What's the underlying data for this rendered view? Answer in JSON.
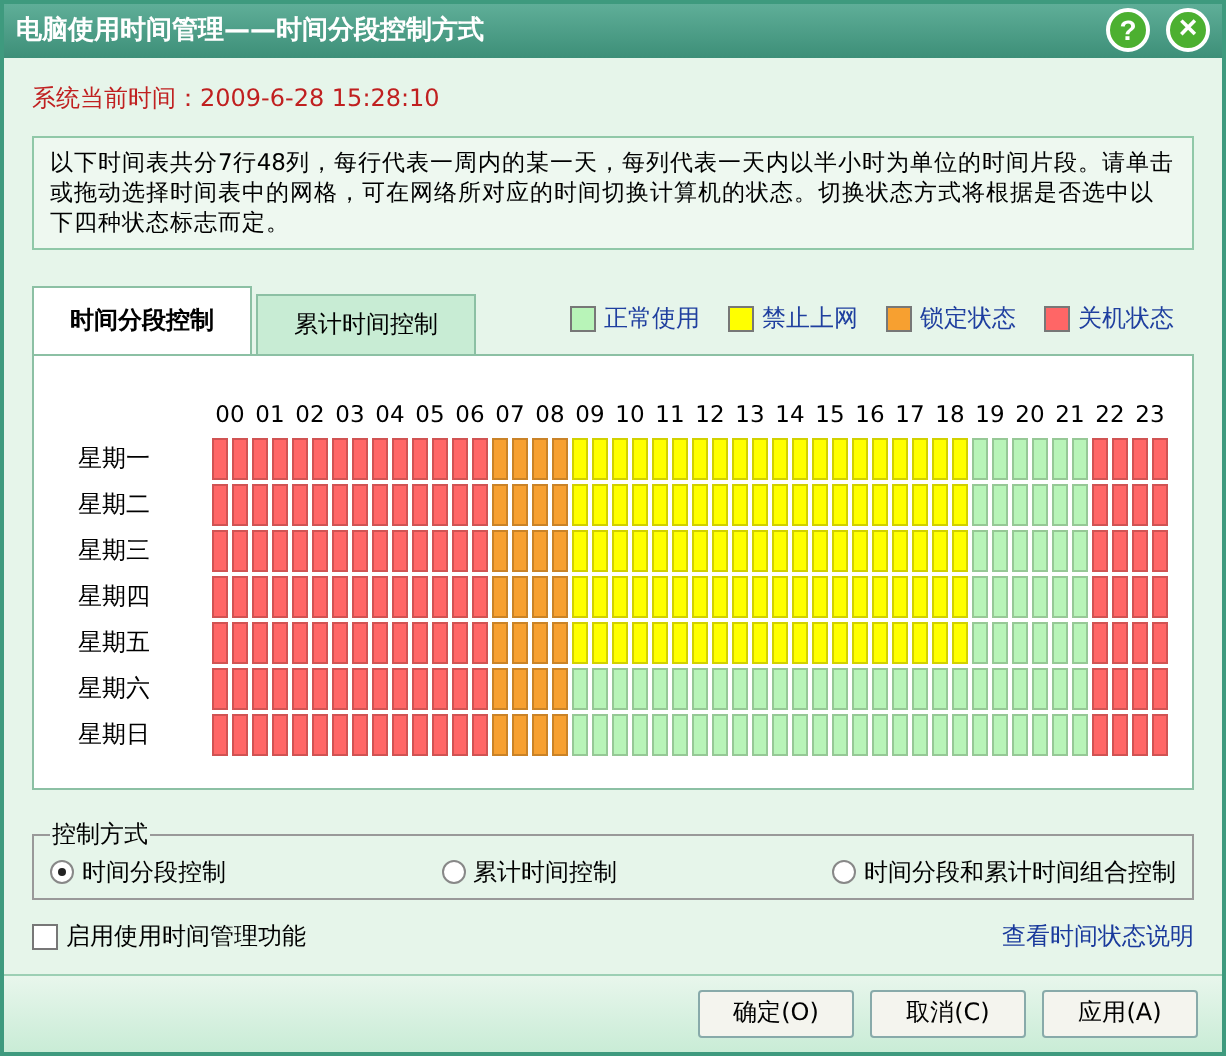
{
  "window": {
    "title": "电脑使用时间管理——时间分段控制方式",
    "buttons": [
      {
        "kind": "help",
        "label": "?"
      },
      {
        "kind": "close",
        "label": "×"
      }
    ]
  },
  "system_time": "系统当前时间：2009-6-28 15:28:10",
  "description": "以下时间表共分7行48列，每行代表一周内的某一天，每列代表一天内以半小时为单位的时间片段。请单击或拖动选择时间表中的网格，可在网络所对应的时间切换计算机的状态。切换状态方式将根据是否选中以下四种状态标志而定。",
  "tabs": [
    {
      "label": "时间分段控制",
      "selected": true
    },
    {
      "label": "累计时间控制",
      "selected": false
    }
  ],
  "legend": [
    {
      "kind": "normal",
      "label": "正常使用",
      "color": "#b8f4b8"
    },
    {
      "kind": "blocked",
      "label": "禁止上网",
      "color": "#ffff00"
    },
    {
      "kind": "locked",
      "label": "锁定状态",
      "color": "#f7a030"
    },
    {
      "kind": "off",
      "label": "关机状态",
      "color": "#ff6666"
    }
  ],
  "grid": {
    "hours": [
      "00",
      "01",
      "02",
      "03",
      "04",
      "05",
      "06",
      "07",
      "08",
      "09",
      "10",
      "11",
      "12",
      "13",
      "14",
      "15",
      "16",
      "17",
      "18",
      "19",
      "20",
      "21",
      "22",
      "23"
    ],
    "rows": [
      {
        "day": "星期一",
        "cells": [
          {
            "kind": "off"
          },
          {
            "kind": "off"
          },
          {
            "kind": "off"
          },
          {
            "kind": "off"
          },
          {
            "kind": "off"
          },
          {
            "kind": "off"
          },
          {
            "kind": "off"
          },
          {
            "kind": "off"
          },
          {
            "kind": "off"
          },
          {
            "kind": "off"
          },
          {
            "kind": "off"
          },
          {
            "kind": "off"
          },
          {
            "kind": "off"
          },
          {
            "kind": "off"
          },
          {
            "kind": "locked"
          },
          {
            "kind": "locked"
          },
          {
            "kind": "locked"
          },
          {
            "kind": "locked"
          },
          {
            "kind": "blocked"
          },
          {
            "kind": "blocked"
          },
          {
            "kind": "blocked"
          },
          {
            "kind": "blocked"
          },
          {
            "kind": "blocked"
          },
          {
            "kind": "blocked"
          },
          {
            "kind": "blocked"
          },
          {
            "kind": "blocked"
          },
          {
            "kind": "blocked"
          },
          {
            "kind": "blocked"
          },
          {
            "kind": "blocked"
          },
          {
            "kind": "blocked"
          },
          {
            "kind": "blocked"
          },
          {
            "kind": "blocked"
          },
          {
            "kind": "blocked"
          },
          {
            "kind": "blocked"
          },
          {
            "kind": "blocked"
          },
          {
            "kind": "blocked"
          },
          {
            "kind": "blocked"
          },
          {
            "kind": "blocked"
          },
          {
            "kind": "normal"
          },
          {
            "kind": "normal"
          },
          {
            "kind": "normal"
          },
          {
            "kind": "normal"
          },
          {
            "kind": "normal"
          },
          {
            "kind": "normal"
          },
          {
            "kind": "off"
          },
          {
            "kind": "off"
          },
          {
            "kind": "off"
          },
          {
            "kind": "off"
          }
        ]
      },
      {
        "day": "星期二",
        "cells": [
          {
            "kind": "off"
          },
          {
            "kind": "off"
          },
          {
            "kind": "off"
          },
          {
            "kind": "off"
          },
          {
            "kind": "off"
          },
          {
            "kind": "off"
          },
          {
            "kind": "off"
          },
          {
            "kind": "off"
          },
          {
            "kind": "off"
          },
          {
            "kind": "off"
          },
          {
            "kind": "off"
          },
          {
            "kind": "off"
          },
          {
            "kind": "off"
          },
          {
            "kind": "off"
          },
          {
            "kind": "locked"
          },
          {
            "kind": "locked"
          },
          {
            "kind": "locked"
          },
          {
            "kind": "locked"
          },
          {
            "kind": "blocked"
          },
          {
            "kind": "blocked"
          },
          {
            "kind": "blocked"
          },
          {
            "kind": "blocked"
          },
          {
            "kind": "blocked"
          },
          {
            "kind": "blocked"
          },
          {
            "kind": "blocked"
          },
          {
            "kind": "blocked"
          },
          {
            "kind": "blocked"
          },
          {
            "kind": "blocked"
          },
          {
            "kind": "blocked"
          },
          {
            "kind": "blocked"
          },
          {
            "kind": "blocked"
          },
          {
            "kind": "blocked"
          },
          {
            "kind": "blocked"
          },
          {
            "kind": "blocked"
          },
          {
            "kind": "blocked"
          },
          {
            "kind": "blocked"
          },
          {
            "kind": "blocked"
          },
          {
            "kind": "blocked"
          },
          {
            "kind": "normal"
          },
          {
            "kind": "normal"
          },
          {
            "kind": "normal"
          },
          {
            "kind": "normal"
          },
          {
            "kind": "normal"
          },
          {
            "kind": "normal"
          },
          {
            "kind": "off"
          },
          {
            "kind": "off"
          },
          {
            "kind": "off"
          },
          {
            "kind": "off"
          }
        ]
      },
      {
        "day": "星期三",
        "cells": [
          {
            "kind": "off"
          },
          {
            "kind": "off"
          },
          {
            "kind": "off"
          },
          {
            "kind": "off"
          },
          {
            "kind": "off"
          },
          {
            "kind": "off"
          },
          {
            "kind": "off"
          },
          {
            "kind": "off"
          },
          {
            "kind": "off"
          },
          {
            "kind": "off"
          },
          {
            "kind": "off"
          },
          {
            "kind": "off"
          },
          {
            "kind": "off"
          },
          {
            "kind": "off"
          },
          {
            "kind": "locked"
          },
          {
            "kind": "locked"
          },
          {
            "kind": "locked"
          },
          {
            "kind": "locked"
          },
          {
            "kind": "blocked"
          },
          {
            "kind": "blocked"
          },
          {
            "kind": "blocked"
          },
          {
            "kind": "blocked"
          },
          {
            "kind": "blocked"
          },
          {
            "kind": "blocked"
          },
          {
            "kind": "blocked"
          },
          {
            "kind": "blocked"
          },
          {
            "kind": "blocked"
          },
          {
            "kind": "blocked"
          },
          {
            "kind": "blocked"
          },
          {
            "kind": "blocked"
          },
          {
            "kind": "blocked"
          },
          {
            "kind": "blocked"
          },
          {
            "kind": "blocked"
          },
          {
            "kind": "blocked"
          },
          {
            "kind": "blocked"
          },
          {
            "kind": "blocked"
          },
          {
            "kind": "blocked"
          },
          {
            "kind": "blocked"
          },
          {
            "kind": "normal"
          },
          {
            "kind": "normal"
          },
          {
            "kind": "normal"
          },
          {
            "kind": "normal"
          },
          {
            "kind": "normal"
          },
          {
            "kind": "normal"
          },
          {
            "kind": "off"
          },
          {
            "kind": "off"
          },
          {
            "kind": "off"
          },
          {
            "kind": "off"
          }
        ]
      },
      {
        "day": "星期四",
        "cells": [
          {
            "kind": "off"
          },
          {
            "kind": "off"
          },
          {
            "kind": "off"
          },
          {
            "kind": "off"
          },
          {
            "kind": "off"
          },
          {
            "kind": "off"
          },
          {
            "kind": "off"
          },
          {
            "kind": "off"
          },
          {
            "kind": "off"
          },
          {
            "kind": "off"
          },
          {
            "kind": "off"
          },
          {
            "kind": "off"
          },
          {
            "kind": "off"
          },
          {
            "kind": "off"
          },
          {
            "kind": "locked"
          },
          {
            "kind": "locked"
          },
          {
            "kind": "locked"
          },
          {
            "kind": "locked"
          },
          {
            "kind": "blocked"
          },
          {
            "kind": "blocked"
          },
          {
            "kind": "blocked"
          },
          {
            "kind": "blocked"
          },
          {
            "kind": "blocked"
          },
          {
            "kind": "blocked"
          },
          {
            "kind": "blocked"
          },
          {
            "kind": "blocked"
          },
          {
            "kind": "blocked"
          },
          {
            "kind": "blocked"
          },
          {
            "kind": "blocked"
          },
          {
            "kind": "blocked"
          },
          {
            "kind": "blocked"
          },
          {
            "kind": "blocked"
          },
          {
            "kind": "blocked"
          },
          {
            "kind": "blocked"
          },
          {
            "kind": "blocked"
          },
          {
            "kind": "blocked"
          },
          {
            "kind": "blocked"
          },
          {
            "kind": "blocked"
          },
          {
            "kind": "normal"
          },
          {
            "kind": "normal"
          },
          {
            "kind": "normal"
          },
          {
            "kind": "normal"
          },
          {
            "kind": "normal"
          },
          {
            "kind": "normal"
          },
          {
            "kind": "off"
          },
          {
            "kind": "off"
          },
          {
            "kind": "off"
          },
          {
            "kind": "off"
          }
        ]
      },
      {
        "day": "星期五",
        "cells": [
          {
            "kind": "off"
          },
          {
            "kind": "off"
          },
          {
            "kind": "off"
          },
          {
            "kind": "off"
          },
          {
            "kind": "off"
          },
          {
            "kind": "off"
          },
          {
            "kind": "off"
          },
          {
            "kind": "off"
          },
          {
            "kind": "off"
          },
          {
            "kind": "off"
          },
          {
            "kind": "off"
          },
          {
            "kind": "off"
          },
          {
            "kind": "off"
          },
          {
            "kind": "off"
          },
          {
            "kind": "locked"
          },
          {
            "kind": "locked"
          },
          {
            "kind": "locked"
          },
          {
            "kind": "locked"
          },
          {
            "kind": "blocked"
          },
          {
            "kind": "blocked"
          },
          {
            "kind": "blocked"
          },
          {
            "kind": "blocked"
          },
          {
            "kind": "blocked"
          },
          {
            "kind": "blocked"
          },
          {
            "kind": "blocked"
          },
          {
            "kind": "blocked"
          },
          {
            "kind": "blocked"
          },
          {
            "kind": "blocked"
          },
          {
            "kind": "blocked"
          },
          {
            "kind": "blocked"
          },
          {
            "kind": "blocked"
          },
          {
            "kind": "blocked"
          },
          {
            "kind": "blocked"
          },
          {
            "kind": "blocked"
          },
          {
            "kind": "blocked"
          },
          {
            "kind": "blocked"
          },
          {
            "kind": "blocked"
          },
          {
            "kind": "blocked"
          },
          {
            "kind": "normal"
          },
          {
            "kind": "normal"
          },
          {
            "kind": "normal"
          },
          {
            "kind": "normal"
          },
          {
            "kind": "normal"
          },
          {
            "kind": "normal"
          },
          {
            "kind": "off"
          },
          {
            "kind": "off"
          },
          {
            "kind": "off"
          },
          {
            "kind": "off"
          }
        ]
      },
      {
        "day": "星期六",
        "cells": [
          {
            "kind": "off"
          },
          {
            "kind": "off"
          },
          {
            "kind": "off"
          },
          {
            "kind": "off"
          },
          {
            "kind": "off"
          },
          {
            "kind": "off"
          },
          {
            "kind": "off"
          },
          {
            "kind": "off"
          },
          {
            "kind": "off"
          },
          {
            "kind": "off"
          },
          {
            "kind": "off"
          },
          {
            "kind": "off"
          },
          {
            "kind": "off"
          },
          {
            "kind": "off"
          },
          {
            "kind": "locked"
          },
          {
            "kind": "locked"
          },
          {
            "kind": "locked"
          },
          {
            "kind": "locked"
          },
          {
            "kind": "normal"
          },
          {
            "kind": "normal"
          },
          {
            "kind": "normal"
          },
          {
            "kind": "normal"
          },
          {
            "kind": "normal"
          },
          {
            "kind": "normal"
          },
          {
            "kind": "normal"
          },
          {
            "kind": "normal"
          },
          {
            "kind": "normal"
          },
          {
            "kind": "normal"
          },
          {
            "kind": "normal"
          },
          {
            "kind": "normal"
          },
          {
            "kind": "normal"
          },
          {
            "kind": "normal"
          },
          {
            "kind": "normal"
          },
          {
            "kind": "normal"
          },
          {
            "kind": "normal"
          },
          {
            "kind": "normal"
          },
          {
            "kind": "normal"
          },
          {
            "kind": "normal"
          },
          {
            "kind": "normal"
          },
          {
            "kind": "normal"
          },
          {
            "kind": "normal"
          },
          {
            "kind": "normal"
          },
          {
            "kind": "normal"
          },
          {
            "kind": "normal"
          },
          {
            "kind": "off"
          },
          {
            "kind": "off"
          },
          {
            "kind": "off"
          },
          {
            "kind": "off"
          }
        ]
      },
      {
        "day": "星期日",
        "cells": [
          {
            "kind": "off"
          },
          {
            "kind": "off"
          },
          {
            "kind": "off"
          },
          {
            "kind": "off"
          },
          {
            "kind": "off"
          },
          {
            "kind": "off"
          },
          {
            "kind": "off"
          },
          {
            "kind": "off"
          },
          {
            "kind": "off"
          },
          {
            "kind": "off"
          },
          {
            "kind": "off"
          },
          {
            "kind": "off"
          },
          {
            "kind": "off"
          },
          {
            "kind": "off"
          },
          {
            "kind": "locked"
          },
          {
            "kind": "locked"
          },
          {
            "kind": "locked"
          },
          {
            "kind": "locked"
          },
          {
            "kind": "normal"
          },
          {
            "kind": "normal"
          },
          {
            "kind": "normal"
          },
          {
            "kind": "normal"
          },
          {
            "kind": "normal"
          },
          {
            "kind": "normal"
          },
          {
            "kind": "normal"
          },
          {
            "kind": "normal"
          },
          {
            "kind": "normal"
          },
          {
            "kind": "normal"
          },
          {
            "kind": "normal"
          },
          {
            "kind": "normal"
          },
          {
            "kind": "normal"
          },
          {
            "kind": "normal"
          },
          {
            "kind": "normal"
          },
          {
            "kind": "normal"
          },
          {
            "kind": "normal"
          },
          {
            "kind": "normal"
          },
          {
            "kind": "normal"
          },
          {
            "kind": "normal"
          },
          {
            "kind": "normal"
          },
          {
            "kind": "normal"
          },
          {
            "kind": "normal"
          },
          {
            "kind": "normal"
          },
          {
            "kind": "normal"
          },
          {
            "kind": "normal"
          },
          {
            "kind": "off"
          },
          {
            "kind": "off"
          },
          {
            "kind": "off"
          },
          {
            "kind": "off"
          }
        ]
      }
    ]
  },
  "control_mode": {
    "title": "控制方式",
    "options": [
      {
        "label": "时间分段控制",
        "selected": true
      },
      {
        "label": "累计时间控制",
        "selected": false
      },
      {
        "label": "时间分段和累计时间组合控制",
        "selected": false
      }
    ]
  },
  "enable": {
    "label": "启用使用时间管理功能",
    "checked": false
  },
  "help_link": "查看时间状态说明",
  "buttons": [
    "确定(O)",
    "取消(C)",
    "应用(A)"
  ]
}
